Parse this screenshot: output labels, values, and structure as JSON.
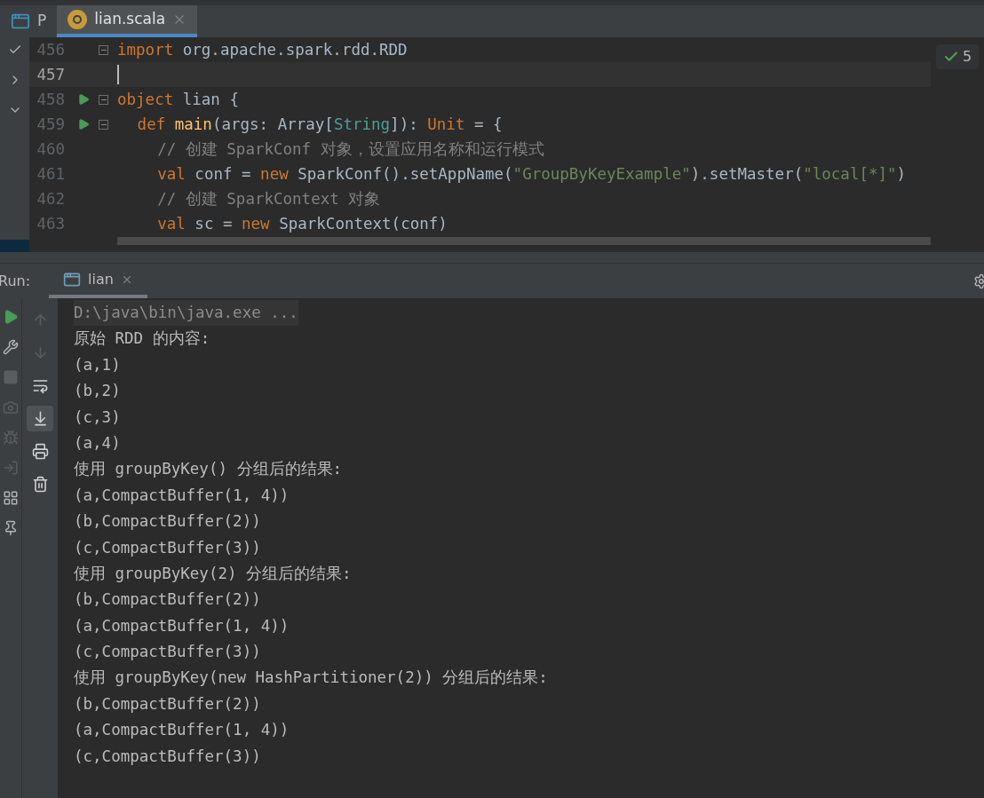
{
  "editor_tabs": [
    {
      "label": "P",
      "selected": false,
      "kind": "window",
      "closable": false
    },
    {
      "label": "lian.scala",
      "selected": true,
      "kind": "file",
      "closable": true
    }
  ],
  "inspection_badge": {
    "count": "5"
  },
  "code_lines": [
    {
      "number": "456",
      "run": false,
      "fold": true,
      "current": false,
      "tokens": [
        {
          "kind": "keyword",
          "text": "import "
        },
        {
          "kind": "plain",
          "text": "org.apache.spark.rdd.RDD"
        }
      ]
    },
    {
      "number": "457",
      "run": false,
      "fold": false,
      "current": true
    },
    {
      "number": "458",
      "run": true,
      "fold": true,
      "current": false,
      "tokens": [
        {
          "kind": "keyword",
          "text": "object "
        },
        {
          "kind": "plain",
          "text": "lian {"
        }
      ],
      "children": [
        {
          "number": "459",
          "run": true,
          "fold": true,
          "current": false,
          "tokens": [
            {
              "kind": "keyword",
              "text": "def "
            },
            {
              "kind": "function",
              "text": "main"
            },
            {
              "kind": "plain",
              "text": "(args: Array["
            },
            {
              "kind": "type",
              "text": "String"
            },
            {
              "kind": "plain",
              "text": "]): "
            },
            {
              "kind": "keyword",
              "text": "Unit"
            },
            {
              "kind": "plain",
              "text": " = {"
            }
          ],
          "children": [
            {
              "number": "460",
              "run": false,
              "fold": false,
              "current": false,
              "tokens": [
                {
                  "kind": "comment",
                  "text": "// 创建 SparkConf 对象，设置应用名称和运行模式"
                }
              ]
            },
            {
              "number": "461",
              "run": false,
              "fold": false,
              "current": false,
              "tokens": [
                {
                  "kind": "keyword",
                  "text": "val "
                },
                {
                  "kind": "plain",
                  "text": "conf = "
                },
                {
                  "kind": "keyword",
                  "text": "new "
                },
                {
                  "kind": "plain",
                  "text": "SparkConf().setAppName("
                },
                {
                  "kind": "string",
                  "text": "\"GroupByKeyExample\""
                },
                {
                  "kind": "plain",
                  "text": ").setMaster("
                },
                {
                  "kind": "string",
                  "text": "\"local[*]\""
                },
                {
                  "kind": "plain",
                  "text": ")"
                }
              ]
            },
            {
              "number": "462",
              "run": false,
              "fold": false,
              "current": false,
              "tokens": [
                {
                  "kind": "comment",
                  "text": "// 创建 SparkContext 对象"
                }
              ]
            },
            {
              "number": "463",
              "run": false,
              "fold": false,
              "current": false,
              "tokens": [
                {
                  "kind": "keyword",
                  "text": "val "
                },
                {
                  "kind": "plain",
                  "text": "sc = "
                },
                {
                  "kind": "keyword",
                  "text": "new "
                },
                {
                  "kind": "plain",
                  "text": "SparkContext(conf)"
                }
              ]
            }
          ]
        }
      ]
    }
  ],
  "run_panel": {
    "label": "Run:",
    "tabs": [
      {
        "label": "lian",
        "selected": true,
        "closable": true
      }
    ],
    "left_toolbar": [
      {
        "kind": "rerun"
      },
      {
        "kind": "wrench"
      },
      {
        "kind": "stop"
      },
      {
        "kind": "camera"
      },
      {
        "kind": "bug"
      },
      {
        "kind": "import"
      },
      {
        "kind": "layout"
      },
      {
        "kind": "pin"
      }
    ],
    "console_toolbar": [
      {
        "kind": "up",
        "selected": false,
        "disabled": true
      },
      {
        "kind": "down",
        "selected": false,
        "disabled": true
      },
      {
        "kind": "wrap",
        "selected": false,
        "disabled": false
      },
      {
        "kind": "scroll-end",
        "selected": true,
        "disabled": false
      },
      {
        "kind": "print",
        "selected": false,
        "disabled": false
      },
      {
        "kind": "trash",
        "selected": false,
        "disabled": false
      }
    ],
    "output": [
      {
        "kind": "command",
        "text": "D:\\java\\bin\\java.exe ..."
      },
      {
        "kind": "stdout",
        "text": "原始 RDD 的内容:"
      },
      {
        "kind": "stdout",
        "text": "(a,1)"
      },
      {
        "kind": "stdout",
        "text": "(b,2)"
      },
      {
        "kind": "stdout",
        "text": "(c,3)"
      },
      {
        "kind": "stdout",
        "text": "(a,4)"
      },
      {
        "kind": "stdout",
        "text": "使用 groupByKey() 分组后的结果:"
      },
      {
        "kind": "stdout",
        "text": "(a,CompactBuffer(1, 4))"
      },
      {
        "kind": "stdout",
        "text": "(b,CompactBuffer(2))"
      },
      {
        "kind": "stdout",
        "text": "(c,CompactBuffer(3))"
      },
      {
        "kind": "stdout",
        "text": "使用 groupByKey(2) 分组后的结果:"
      },
      {
        "kind": "stdout",
        "text": "(b,CompactBuffer(2))"
      },
      {
        "kind": "stdout",
        "text": "(a,CompactBuffer(1, 4))"
      },
      {
        "kind": "stdout",
        "text": "(c,CompactBuffer(3))"
      },
      {
        "kind": "stdout",
        "text": "使用 groupByKey(new HashPartitioner(2)) 分组后的结果:"
      },
      {
        "kind": "stdout",
        "text": "(b,CompactBuffer(2))"
      },
      {
        "kind": "stdout",
        "text": "(a,CompactBuffer(1, 4))"
      },
      {
        "kind": "stdout",
        "text": "(c,CompactBuffer(3))"
      }
    ]
  }
}
